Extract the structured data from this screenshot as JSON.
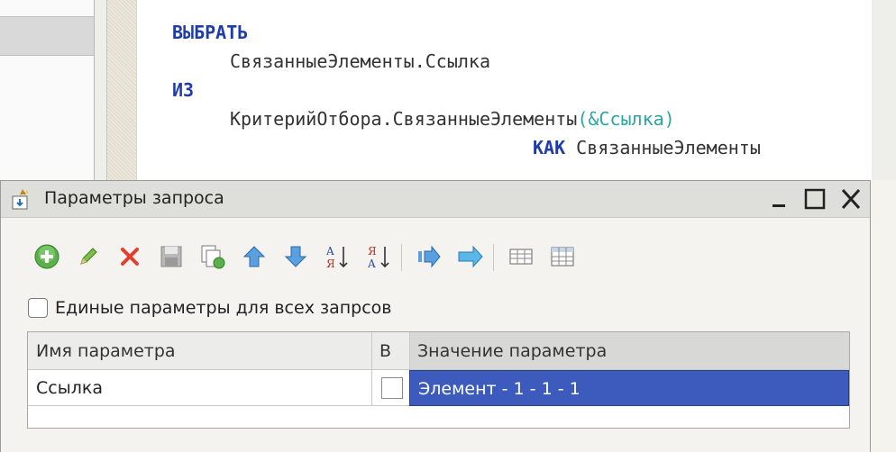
{
  "code": {
    "keyword_select": "ВЫБРАТЬ",
    "field_line": "СвязанныеЭлементы.Ссылка",
    "keyword_from": "ИЗ",
    "source_func": "КритерийОтбора.СвязанныеЭлементы",
    "source_paren_open": "(",
    "source_param": "&Ссылка",
    "source_paren_close": ")",
    "keyword_as": "КАК",
    "alias": "СвязанныеЭлементы"
  },
  "dialog": {
    "title": "Параметры запроса",
    "window_buttons": {
      "minimize": "minimize-icon",
      "maximize": "maximize-icon",
      "close": "close-icon"
    },
    "toolbar": [
      "add-icon",
      "edit-icon",
      "delete-icon",
      "save-icon",
      "copy-icon",
      "move-up-icon",
      "move-down-icon",
      "sort-asc-icon",
      "sort-desc-icon",
      "forward-icon",
      "arrow-right-icon",
      "table-icon",
      "grid-icon"
    ],
    "checkbox_label": "Единые параметры для всех запрсов",
    "checkbox_checked": false,
    "table": {
      "columns": [
        "Имя параметра",
        "В",
        "Значение параметра"
      ],
      "rows": [
        {
          "name": "Ссылка",
          "expression": false,
          "value": "Элемент - 1 - 1 - 1"
        }
      ]
    }
  },
  "colors": {
    "keyword": "#1e3caa",
    "param": "#2aa7a0",
    "selection": "#3c5bbd"
  }
}
